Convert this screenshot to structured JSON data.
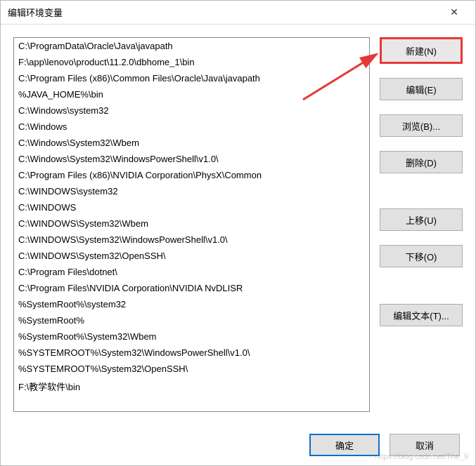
{
  "title": "编辑环境变量",
  "list_items": [
    "C:\\ProgramData\\Oracle\\Java\\javapath",
    "F:\\app\\lenovo\\product\\11.2.0\\dbhome_1\\bin",
    "C:\\Program Files (x86)\\Common Files\\Oracle\\Java\\javapath",
    "%JAVA_HOME%\\bin",
    "C:\\Windows\\system32",
    "C:\\Windows",
    "C:\\Windows\\System32\\Wbem",
    "C:\\Windows\\System32\\WindowsPowerShell\\v1.0\\",
    "C:\\Program Files (x86)\\NVIDIA Corporation\\PhysX\\Common",
    "C:\\WINDOWS\\system32",
    "C:\\WINDOWS",
    "C:\\WINDOWS\\System32\\Wbem",
    "C:\\WINDOWS\\System32\\WindowsPowerShell\\v1.0\\",
    "C:\\WINDOWS\\System32\\OpenSSH\\",
    "C:\\Program Files\\dotnet\\",
    "C:\\Program Files\\NVIDIA Corporation\\NVIDIA NvDLISR",
    "%SystemRoot%\\system32",
    "%SystemRoot%",
    "%SystemRoot%\\System32\\Wbem",
    "%SYSTEMROOT%\\System32\\WindowsPowerShell\\v1.0\\",
    "%SYSTEMROOT%\\System32\\OpenSSH\\",
    "F:\\教学软件\\bin"
  ],
  "buttons": {
    "new": "新建(N)",
    "edit": "编辑(E)",
    "browse": "浏览(B)...",
    "delete": "删除(D)",
    "move_up": "上移(U)",
    "move_down": "下移(O)",
    "edit_text": "编辑文本(T)..."
  },
  "footer": {
    "ok": "确定",
    "cancel": "取消"
  },
  "watermark": "https://blog.csdn.net/The_9"
}
